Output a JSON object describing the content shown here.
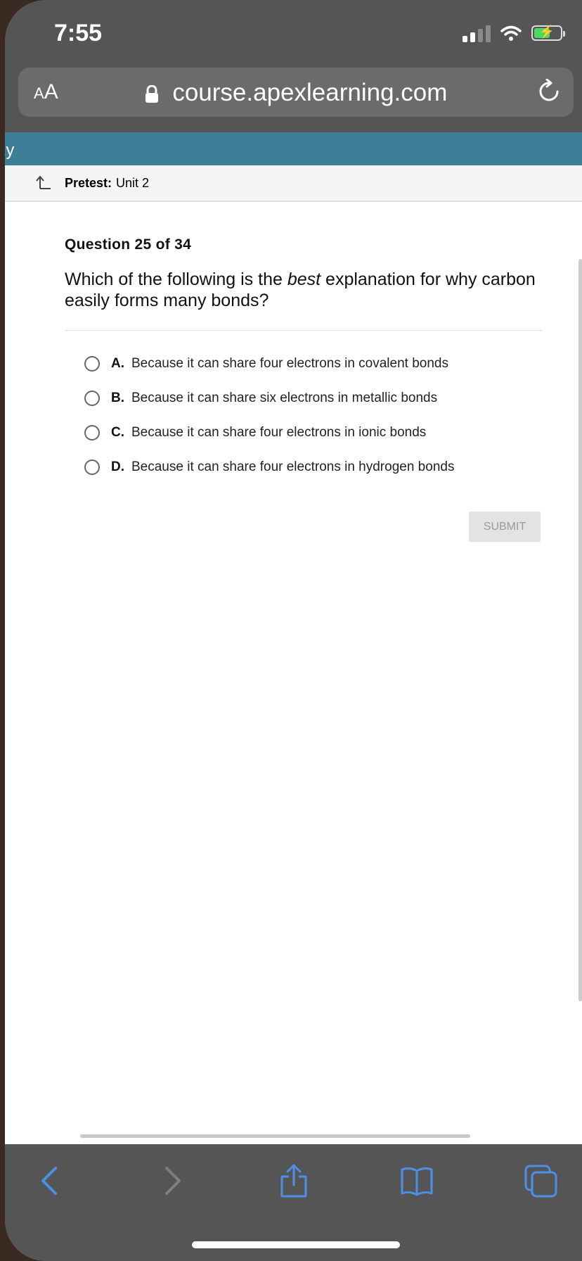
{
  "status": {
    "time": "7:55"
  },
  "browser": {
    "aa_small": "A",
    "aa_big": "A",
    "url": "course.apexlearning.com"
  },
  "page": {
    "top_fragment": "ιy",
    "breadcrumb": {
      "label": "Pretest:",
      "unit": "Unit 2"
    },
    "question_number": "Question 25 of 34",
    "question": {
      "before": "Which of the following is the ",
      "emphasis": "best",
      "after": " explanation for why carbon easily forms many bonds?"
    },
    "choices": [
      {
        "letter": "A.",
        "text": "Because it can share four electrons in covalent bonds"
      },
      {
        "letter": "B.",
        "text": "Because it can share six electrons in metallic bonds"
      },
      {
        "letter": "C.",
        "text": "Because it can share four electrons in ionic bonds"
      },
      {
        "letter": "D.",
        "text": "Because it can share four electrons in hydrogen bonds"
      }
    ],
    "submit_label": "SUBMIT"
  },
  "colors": {
    "header": "#3c7f97",
    "browser_chrome": "#555555",
    "toolbar_icon": "#4d8fe6"
  },
  "icons": [
    "lock-icon",
    "reload-icon",
    "back-icon",
    "forward-icon",
    "share-icon",
    "bookmarks-icon",
    "tabs-icon"
  ]
}
